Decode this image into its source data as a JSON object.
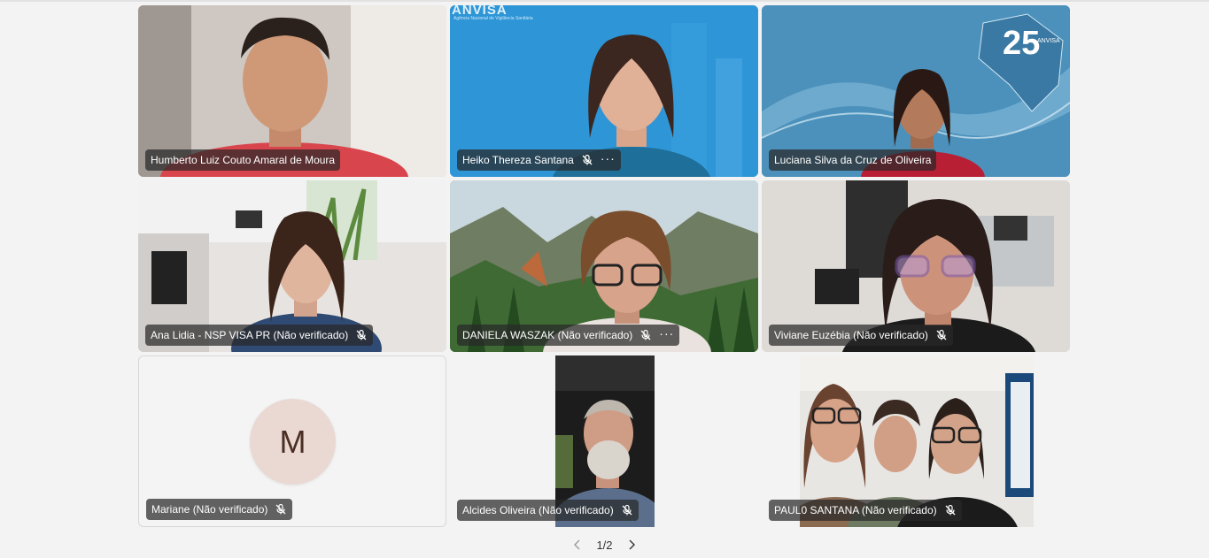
{
  "participants": [
    {
      "name": "Humberto Luiz Couto Amaral de Moura",
      "muted": false,
      "more": false
    },
    {
      "name": "Heiko Thereza Santana",
      "muted": true,
      "more": true,
      "bg_text": "ANVISA",
      "bg_subtext": "Agência Nacional de Vigilância Sanitária"
    },
    {
      "name": "Luciana Silva da Cruz de Oliveira",
      "muted": false,
      "more": false,
      "badge": "25",
      "badge_text": "ANVISA"
    },
    {
      "name": "Ana Lidia - NSP VISA PR (Não verificado)",
      "muted": true,
      "more": false
    },
    {
      "name": "DANIELA WASZAK (Não verificado)",
      "muted": true,
      "more": true
    },
    {
      "name": "Viviane Euzébia (Não verificado)",
      "muted": true,
      "more": false
    },
    {
      "name": "Mariane (Não verificado)",
      "muted": true,
      "more": false,
      "avatar_initial": "M"
    },
    {
      "name": "Alcides Oliveira (Não verificado)",
      "muted": true,
      "more": false
    },
    {
      "name": "PAUL0 SANTANA (Não verificado)",
      "muted": true,
      "more": false
    }
  ],
  "pager": {
    "label": "1/2"
  },
  "icons": {
    "mic_off": "mic-off-icon",
    "more": "more-options-icon",
    "prev": "chevron-left-icon",
    "next": "chevron-right-icon"
  },
  "colors": {
    "nametag_bg": "#282828",
    "avatar_bg": "#ead9d3",
    "anvisa_blue": "#2b8fd0"
  }
}
